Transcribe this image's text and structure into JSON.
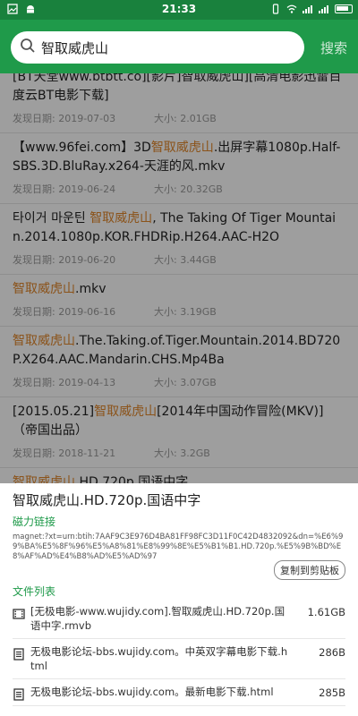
{
  "status": {
    "time": "21:33"
  },
  "search": {
    "query": "智取威虎山",
    "button": "搜索"
  },
  "results": [
    {
      "parts": [
        [
          "[BT天堂www.btbtt.co][影片]智取威虎山][高清电影迅雷百度云BT电影下载]",
          ""
        ]
      ],
      "date": "发现日期: 2019-07-03",
      "size": "大小: 2.01GB"
    },
    {
      "parts": [
        [
          "【www.96fei.com】3D",
          ""
        ],
        [
          "智取威虎山",
          "hl"
        ],
        [
          ".出屏字幕1080p.Half-SBS.3D.BluRay.x264-天涯的风.mkv",
          ""
        ]
      ],
      "date": "发现日期: 2019-06-24",
      "size": "大小: 20.32GB"
    },
    {
      "parts": [
        [
          "타이거 마운틴 ",
          ""
        ],
        [
          "智取威虎山",
          "hl"
        ],
        [
          ", The Taking Of Tiger Mountain.2014.1080p.KOR.FHDRip.H264.AAC-H2O",
          ""
        ]
      ],
      "date": "发现日期: 2019-06-20",
      "size": "大小: 3.44GB"
    },
    {
      "parts": [
        [
          "智取威虎山",
          "hl"
        ],
        [
          ".mkv",
          ""
        ]
      ],
      "date": "发现日期: 2019-06-16",
      "size": "大小: 3.19GB"
    },
    {
      "parts": [
        [
          "智取威虎山",
          "hl"
        ],
        [
          ".The.Taking.of.Tiger.Mountain.2014.BD720P.X264.AAC.Mandarin.CHS.Mp4Ba",
          ""
        ]
      ],
      "date": "发现日期: 2019-04-13",
      "size": "大小: 3.07GB"
    },
    {
      "parts": [
        [
          "[2015.05.21]",
          ""
        ],
        [
          "智取威虎山",
          "hl"
        ],
        [
          "[2014年中国动作冒险(MKV)]（帝国出品）",
          ""
        ]
      ],
      "date": "发现日期: 2018-11-21",
      "size": "大小: 3.2GB"
    },
    {
      "parts": [
        [
          "智取威虎山",
          "hl"
        ],
        [
          ".HD.720p.国语中字",
          ""
        ]
      ],
      "date": "",
      "size": ""
    }
  ],
  "sheet": {
    "title": "智取威虎山.HD.720p.国语中字",
    "magnet_label": "磁力链接",
    "magnet": "magnet:?xt=urn:btih:7AAF9C3E976D4BA81FF98FC3D11F0C42D4832092&dn=%E6%99%BA%E5%8F%96%E5%A8%81%E8%99%8E%E5%B1%B1.HD.720p.%E5%9B%BD%E8%AF%AD%E4%B8%AD%E5%AD%97",
    "copy_button": "复制到剪贴板",
    "files_label": "文件列表",
    "files": [
      {
        "icon": "video-file-icon",
        "name": "[无极电影-www.wujidy.com].智取威虎山.HD.720p.国语中字.rmvb",
        "size": "1.61GB"
      },
      {
        "icon": "document-file-icon",
        "name": "无极电影论坛-bbs.wujidy.com。中英双字幕电影下载.html",
        "size": "286B"
      },
      {
        "icon": "document-file-icon",
        "name": "无极电影论坛-bbs.wujidy.com。最新电影下载.html",
        "size": "285B"
      }
    ]
  }
}
